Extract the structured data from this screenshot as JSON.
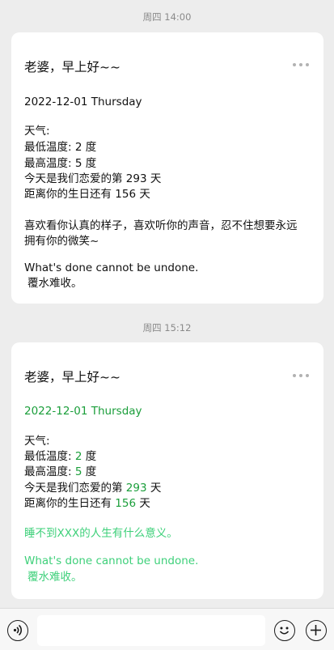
{
  "messages": [
    {
      "time": "周四 14:00",
      "title": "老婆，早上好~~",
      "date": "2022-12-01 Thursday",
      "weather_label": "天气:",
      "low_prefix": "最低温度:",
      "low_value": "2",
      "high_prefix": "最高温度:",
      "high_value": "5",
      "love_prefix": "今天是我们恋爱的第",
      "love_days": "293",
      "birthday_prefix": "距离你的生日还有",
      "birthday_days": "156",
      "unit_degree": "度",
      "unit_day": "天",
      "sentence_line1": "喜欢看你认真的样子，喜欢听你的声音，忍不住想要永远",
      "sentence_line2": "拥有你的微笑~",
      "quote_en": "What's done cannot be undone.",
      "quote_zh": "覆水难收。"
    },
    {
      "time": "周四 15:12",
      "title": "老婆，早上好~~",
      "date": "2022-12-01 Thursday",
      "weather_label": "天气:",
      "low_prefix": "最低温度:",
      "low_value": "2",
      "high_prefix": "最高温度:",
      "high_value": "5",
      "love_prefix": "今天是我们恋爱的第",
      "love_days": "293",
      "birthday_prefix": "距离你的生日还有",
      "birthday_days": "156",
      "unit_degree": "度",
      "unit_day": "天",
      "sentence_line1": "睡不到XXX的人生有什么意义。",
      "quote_en": "What's done cannot be undone.",
      "quote_zh": "覆水难收。"
    }
  ],
  "colors": {
    "highlight_green": "#1a9e3a",
    "quote_green": "#3ed07a"
  },
  "input_bar": {
    "voice_icon": "voice-icon",
    "emoji_icon": "emoji-icon",
    "plus_icon": "plus-icon",
    "input_value": ""
  }
}
